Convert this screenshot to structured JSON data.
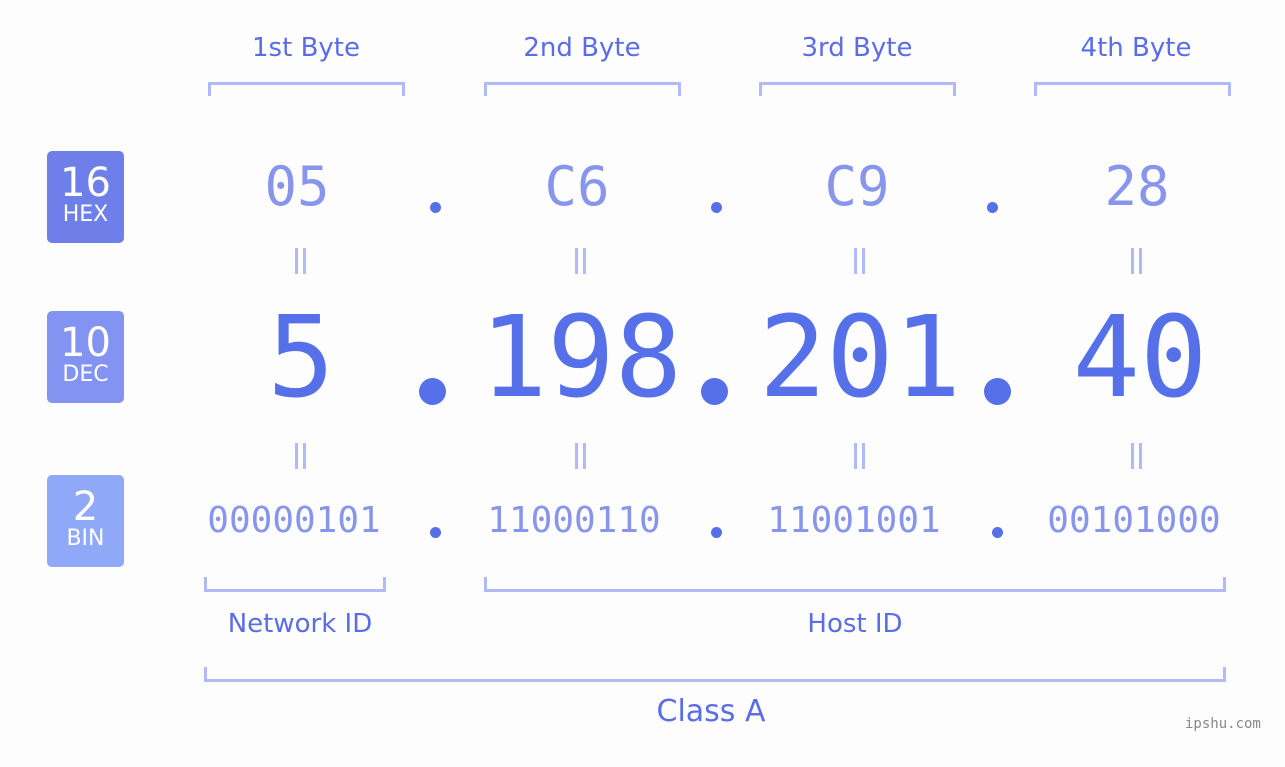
{
  "byte_headers": [
    "1st Byte",
    "2nd Byte",
    "3rd Byte",
    "4th Byte"
  ],
  "bases": {
    "hex": {
      "number": "16",
      "label": "HEX"
    },
    "dec": {
      "number": "10",
      "label": "DEC"
    },
    "bin": {
      "number": "2",
      "label": "BIN"
    }
  },
  "ip": {
    "hex": [
      "05",
      "C6",
      "C9",
      "28"
    ],
    "dec": [
      "5",
      "198",
      "201",
      "40"
    ],
    "bin": [
      "00000101",
      "11000110",
      "11001001",
      "00101000"
    ]
  },
  "segments": {
    "network_id": "Network ID",
    "host_id": "Host ID",
    "class": "Class A"
  },
  "watermark": "ipshu.com",
  "colors": {
    "accent": "#5670e9",
    "bracket": "#b1baf6",
    "badge_hex": "#6f7fe9",
    "badge_dec": "#8393f1",
    "badge_bin": "#8fa8f8"
  }
}
